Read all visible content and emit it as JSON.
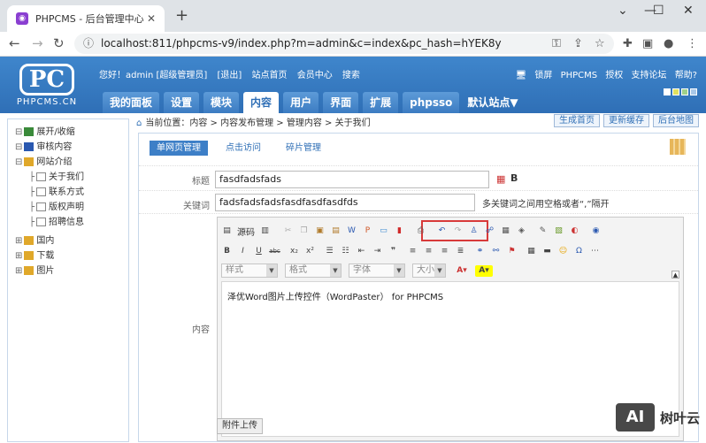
{
  "browser": {
    "tab_title": "PHPCMS - 后台管理中心",
    "url": "localhost:811/phpcms-v9/index.php?m=admin&c=index&pc_hash=hYEK8y"
  },
  "header": {
    "logo_text": "PC",
    "logo_sub": "PHPCMS.CN",
    "top_links": [
      "您好！admin [超级管理员]",
      "[退出]",
      "站点首页",
      "会员中心",
      "搜索"
    ],
    "right_links": [
      "锁屏",
      "PHPCMS",
      "授权",
      "支持论坛",
      "帮助?"
    ],
    "menu": [
      "我的面板",
      "设置",
      "模块",
      "内容",
      "用户",
      "界面",
      "扩展",
      "phpsso"
    ],
    "active_menu": "内容",
    "site_select": "默认站点▼",
    "skin_colors": [
      "#ffffff",
      "#e0e060",
      "#9fd08a",
      "#a8c8e8"
    ]
  },
  "sidebar": {
    "items": [
      {
        "label": "展开/收缩",
        "level": 0,
        "icon": "expand-icon"
      },
      {
        "label": "审核内容",
        "level": 0,
        "icon": "review-icon"
      },
      {
        "label": "网站介绍",
        "level": 0,
        "icon": "folder-icon"
      },
      {
        "label": "关于我们",
        "level": 1,
        "icon": "page-icon"
      },
      {
        "label": "联系方式",
        "level": 1,
        "icon": "page-icon"
      },
      {
        "label": "版权声明",
        "level": 1,
        "icon": "page-icon"
      },
      {
        "label": "招聘信息",
        "level": 1,
        "icon": "page-icon"
      },
      {
        "label": "国内",
        "level": 0,
        "icon": "plus-icon"
      },
      {
        "label": "下载",
        "level": 0,
        "icon": "plus-icon"
      },
      {
        "label": "图片",
        "level": 0,
        "icon": "plus-icon"
      }
    ]
  },
  "breadcrumb": {
    "text": "当前位置：内容 > 内容发布管理 > 管理内容 > 关于我们"
  },
  "actions": [
    "生成首页",
    "更新缓存",
    "后台地图"
  ],
  "subtabs": [
    "单网页管理",
    "点击访问",
    "碎片管理"
  ],
  "form": {
    "title_label": "标题",
    "title_value": "fasdfadsfads",
    "bold_label": "B",
    "keyword_label": "关键词",
    "keyword_value": "fadsfadsfadsfasdfasdfasdfds",
    "keyword_hint": "多关键词之间用空格或者“,”隔开",
    "content_label": "内容",
    "source_label": "源码",
    "selects": [
      "样式",
      "格式",
      "字体",
      "大小"
    ],
    "content_text": "泽优Word图片上传控件（WordPaster） for PHPCMS",
    "upload_label": "附件上传"
  },
  "watermark": {
    "logo": "AI",
    "text": "树叶云"
  }
}
